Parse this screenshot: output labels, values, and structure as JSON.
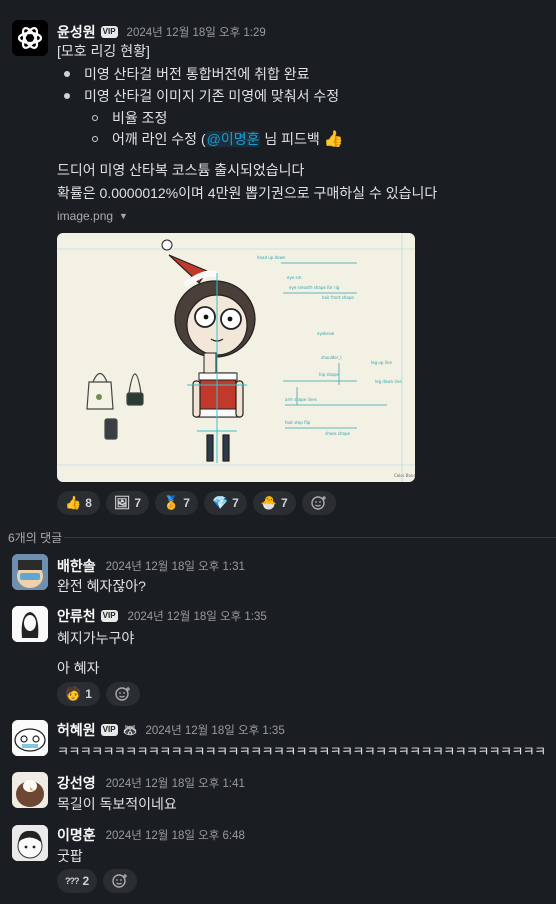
{
  "main": {
    "author": "윤성원",
    "badge": "VIP",
    "timestamp": "2024년 12월 18일 오후 1:29",
    "heading": "[모호 리깅 현황]",
    "bullets": [
      "미영 산타걸 버전 통합버전에 취합 완료",
      "미영 산타걸 이미지 기존 미영에 맞춰서 수정"
    ],
    "sub_bullets": [
      "비율 조정",
      "어깨 라인 수정 ("
    ],
    "mention": "@이명훈",
    "sub_suffix": " 님 피드백",
    "para1": "드디어 미영 산타복 코스튬 출시되었습니다",
    "para2": "확률은 0.0000012%이며 4만원 뽑기권으로 구매하실 수 있습니다",
    "file_name": "image.png",
    "image_caption": "Color Bones",
    "reactions": [
      {
        "icon": "thumbs-up",
        "glyph": "👍",
        "count": "8"
      },
      {
        "icon": "picture",
        "glyph": "🖼",
        "count": "7"
      },
      {
        "icon": "medal",
        "glyph": "🏅",
        "count": "7"
      },
      {
        "icon": "gem",
        "glyph": "💎",
        "count": "7"
      },
      {
        "icon": "chick",
        "glyph": "🐣",
        "count": "7"
      }
    ]
  },
  "thread": {
    "reply_count": "6개의 댓글",
    "replies": [
      {
        "author": "배한솔",
        "time": "2024년 12월 18일 오후 1:31",
        "lines": [
          "완전 혜자잖아?"
        ],
        "vip": false
      },
      {
        "author": "안류천",
        "time": "2024년 12월 18일 오후 1:35",
        "lines": [
          "혜지가누구야",
          "아 혜자"
        ],
        "vip": true,
        "reaction": {
          "glyph": "🧑",
          "count": "1"
        }
      },
      {
        "author": "허혜원",
        "time": "2024년 12월 18일 오후 1:35",
        "lines": [
          "ㅋㅋㅋㅋㅋㅋㅋㅋㅋㅋㅋㅋㅋㅋㅋㅋㅋㅋㅋㅋㅋㅋㅋㅋㅋㅋㅋㅋㅋㅋㅋㅋㅋㅋㅋㅋㅋㅋㅋㅋㅋㅋㅋㅋ"
        ],
        "vip": true
      },
      {
        "author": "강선영",
        "time": "2024년 12월 18일 오후 1:41",
        "lines": [
          "목길이 독보적이네요"
        ],
        "vip": false
      },
      {
        "author": "이명훈",
        "time": "2024년 12월 18일 오후 6:48",
        "lines": [
          "굿팝"
        ],
        "vip": false,
        "reaction": {
          "glyph": "???",
          "count": "2"
        }
      }
    ]
  },
  "colors": {
    "background": "#1a1d21",
    "text": "#d1d2d3",
    "mention": "#1d9bd1",
    "pill": "#2a2d31"
  }
}
